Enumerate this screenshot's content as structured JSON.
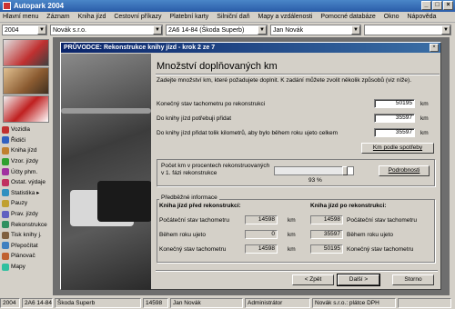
{
  "window": {
    "title": "Autopark 2004",
    "controls": [
      "_",
      "□",
      "×"
    ]
  },
  "menu": [
    "Hlavní menu",
    "Záznam",
    "Kniha jízd",
    "Cestovní příkazy",
    "Platební karty",
    "Silniční daň",
    "Mapy a vzdálenosti",
    "Pomocné databáze",
    "Okno",
    "Nápověda"
  ],
  "toolbar": {
    "year": "2004",
    "company": "Novák s.r.o.",
    "vehicle": "2A6 14-84 (Škoda Superb)",
    "driver": "Jan Novák",
    "extra": ""
  },
  "sidebar": {
    "items": [
      {
        "label": "Vozidla",
        "color": "#c03030"
      },
      {
        "label": "Řidiči",
        "color": "#3060c0"
      },
      {
        "label": "Kniha jízd",
        "color": "#c08030"
      },
      {
        "label": "Vzor. jízdy",
        "color": "#30a030"
      },
      {
        "label": "Účty phm.",
        "color": "#a030a0"
      },
      {
        "label": "Ostat. výdaje",
        "color": "#c03060"
      },
      {
        "label": "Statistika ▸",
        "color": "#3090c0"
      },
      {
        "label": "Pauzy",
        "color": "#c0a030"
      },
      {
        "label": "Prav. jízdy",
        "color": "#6060c0"
      },
      {
        "label": "Rekonstrukce",
        "color": "#309060"
      },
      {
        "label": "Tisk knihy j.",
        "color": "#806040"
      },
      {
        "label": "Přepočítat",
        "color": "#4080c0"
      },
      {
        "label": "Plánovač",
        "color": "#c06030"
      },
      {
        "label": "Mapy",
        "color": "#30c0a0"
      }
    ]
  },
  "dialog": {
    "title": "PRŮVODCE: Rekonstrukce knihy jízd - krok 2 ze 7",
    "heading": "Množství doplňovaných km",
    "description": "Zadejte množství km, které požadujete doplnit. K zadání můžete zvolit několik způsobů (viz níže).",
    "fields": [
      {
        "label": "Konečný stav tachometru po rekonstrukci",
        "value": "50195",
        "unit": "km"
      },
      {
        "label": "Do knihy jízd potřebuji přidat",
        "value": "35597",
        "unit": "km"
      },
      {
        "label": "Do knihy jízd přidat tolik kilometrů, aby bylo během roku ujeto celkem",
        "value": "35597",
        "unit": "km"
      }
    ],
    "km_by_options_button": "Km podle spotřeby",
    "slider": {
      "label_line1": "Počet km v procentech rekonstruovaných",
      "label_line2": "v 1. fázi rekonstrukce",
      "value": "93 %",
      "fraction": 0.93,
      "details_button": "Podrobnosti"
    },
    "preview": {
      "group_label": "Předběžné informace",
      "before_title": "Kniha jízd před rekonstrukcí:",
      "after_title": "Kniha jízd po rekonstrukci:",
      "rows": [
        {
          "label": "Počáteční stav tachometru",
          "before": "14598",
          "after": "14598",
          "unit": "km"
        },
        {
          "label": "Během roku ujeto",
          "before": "0",
          "after": "35597",
          "unit": "km"
        },
        {
          "label": "Konečný stav tachometru",
          "before": "14598",
          "after": "50195",
          "unit": "km"
        }
      ]
    },
    "buttons": {
      "back": "< Zpět",
      "next": "Další >",
      "cancel": "Storno"
    }
  },
  "statusbar": [
    "2004",
    "2A6 14-84",
    "Škoda Superb",
    "14598",
    "Jan Novák",
    "Administrátor",
    "Novák s.r.o.: plátce DPH",
    ""
  ]
}
